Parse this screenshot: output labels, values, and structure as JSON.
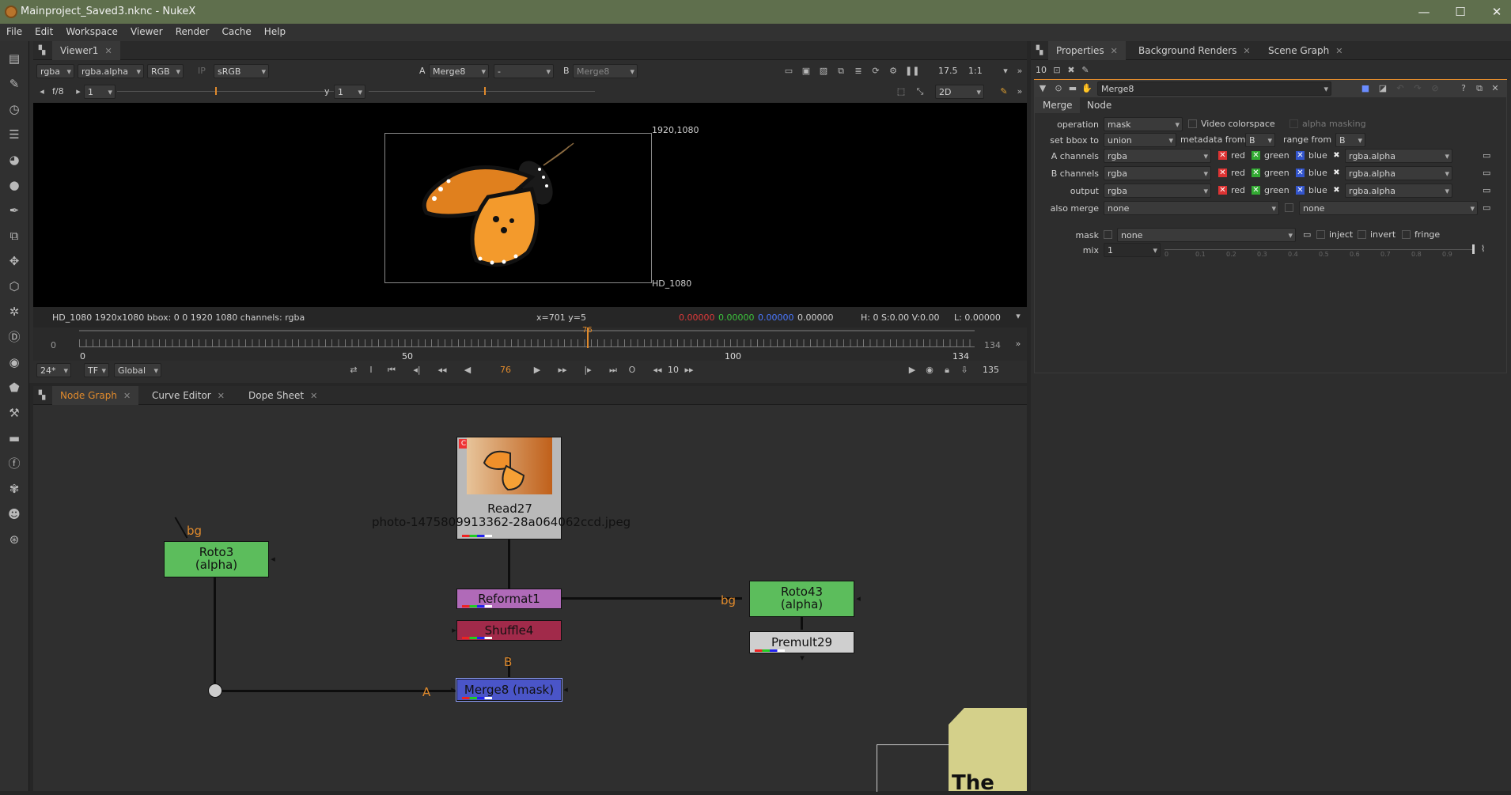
{
  "window": {
    "title": "Mainproject_Saved3.nknc - NukeX",
    "minimize": "—",
    "maximize": "☐",
    "close": "✕"
  },
  "menu": [
    "File",
    "Edit",
    "Workspace",
    "Viewer",
    "Render",
    "Cache",
    "Help"
  ],
  "viewer_tab": {
    "label": "Viewer1"
  },
  "viewer_toolbar": {
    "layer": "rgba",
    "alpha": "rgba.alpha",
    "display": "RGB",
    "ip": "IP",
    "lut": "sRGB",
    "a_label": "A",
    "a_input": "Merge8",
    "mode": "-",
    "b_label": "B",
    "b_input": "Merge8",
    "gain": "17.5",
    "zoom": "1:1"
  },
  "viewer_row2": {
    "fstop": "f/8",
    "frame_val": "1",
    "gamma_label": "y",
    "gamma_val": "1",
    "view_mode": "2D"
  },
  "viewer_image": {
    "corner_top_right": "1920,1080",
    "corner_bottom_right": "HD_1080"
  },
  "status": {
    "info": "HD_1080 1920x1080  bbox: 0 0 1920 1080 channels: rgba",
    "coords": "x=701 y=5",
    "r": "0.00000",
    "g": "0.00000",
    "b": "0.00000",
    "a": "0.00000",
    "hsv": "H:  0 S:0.00 V:0.00",
    "l": "L: 0.00000",
    "colors": {
      "r": "#e03a3a",
      "g": "#3cc23c",
      "b": "#4a78ff"
    }
  },
  "timeline": {
    "start": "0",
    "end": "134",
    "current": 76,
    "current_label": "76",
    "tick_50": "50",
    "tick_100": "100",
    "tick_134": "134",
    "tick_0": "0"
  },
  "transport": {
    "fps": "24*",
    "tf": "TF",
    "scope": "Global",
    "frame": "76",
    "increment": "10",
    "end_frame": "135",
    "in_icon": "I",
    "out_icon": "O"
  },
  "nodegraph_tabs": [
    {
      "label": "Node Graph",
      "active": true
    },
    {
      "label": "Curve Editor",
      "active": false
    },
    {
      "label": "Dope Sheet",
      "active": false
    }
  ],
  "nodes": {
    "read": {
      "title": "Read27",
      "file": "photo-1475809913362-28a064062ccd.jpeg",
      "badge": "C"
    },
    "roto3": {
      "title": "Roto3",
      "sub": "(alpha)",
      "input_label": "bg"
    },
    "reformat": {
      "title": "Reformat1"
    },
    "shuffle": {
      "title": "Shuffle4"
    },
    "merge": {
      "title": "Merge8 (mask)",
      "a_label": "A",
      "b_label": "B"
    },
    "roto43": {
      "title": "Roto43",
      "sub": "(alpha)",
      "input_label": "bg"
    },
    "premult": {
      "title": "Premult29"
    },
    "sticky_text": "The"
  },
  "props_tabs": [
    {
      "label": "Properties",
      "active": true
    },
    {
      "label": "Background Renders",
      "active": false
    },
    {
      "label": "Scene Graph",
      "active": false
    }
  ],
  "props": {
    "max_panels": "10",
    "node_name": "Merge8",
    "subtabs": [
      "Merge",
      "Node"
    ],
    "operation_label": "operation",
    "operation": "mask",
    "video_colorspace": "Video colorspace",
    "alpha_masking": "alpha masking",
    "bbox_label": "set bbox to",
    "bbox": "union",
    "metadata_label": "metadata from",
    "metadata": "B",
    "range_label": "range from",
    "range": "B",
    "channels": [
      {
        "label": "A channels",
        "value": "rgba",
        "alpha": "rgba.alpha"
      },
      {
        "label": "B channels",
        "value": "rgba",
        "alpha": "rgba.alpha"
      },
      {
        "label": "output",
        "value": "rgba",
        "alpha": "rgba.alpha"
      }
    ],
    "chan_red": "red",
    "chan_green": "green",
    "chan_blue": "blue",
    "also_merge_label": "also merge",
    "also_merge": "none",
    "also_merge2": "none",
    "mask_label": "mask",
    "mask": "none",
    "inject": "inject",
    "invert": "invert",
    "fringe": "fringe",
    "mix_label": "mix",
    "mix": "1",
    "mix_ticks": [
      "0",
      "0.1",
      "0.2",
      "0.3",
      "0.4",
      "0.5",
      "0.6",
      "0.7",
      "0.8",
      "0.9"
    ]
  }
}
